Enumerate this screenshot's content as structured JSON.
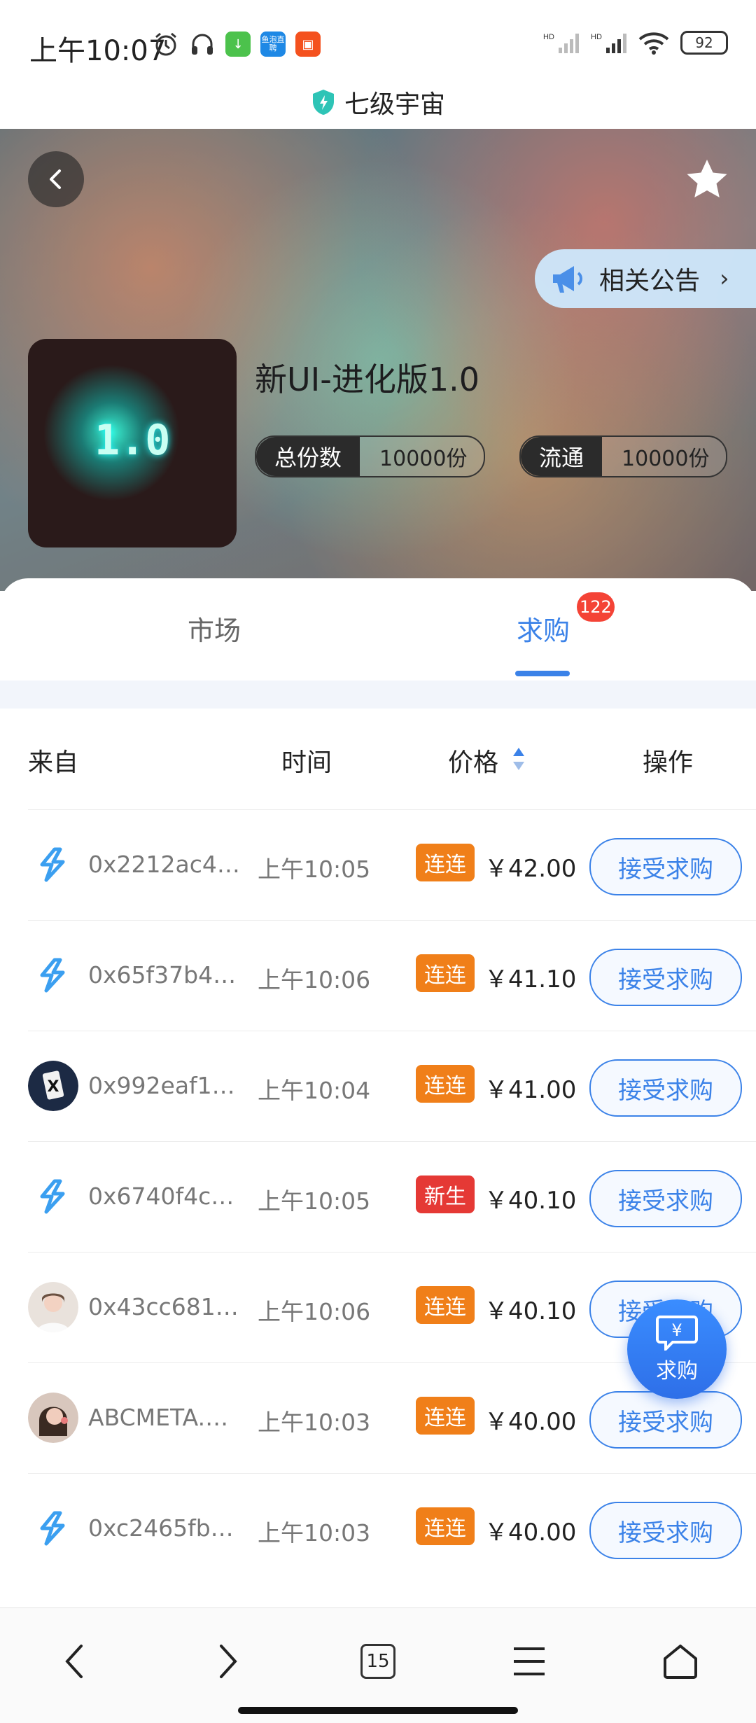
{
  "status_bar": {
    "time": "上午10:07",
    "battery": "92",
    "app_icon_texts": [
      "鱼泡直聘"
    ]
  },
  "app_bar": {
    "title": "七级宇宙"
  },
  "hero": {
    "notice_label": "相关公告",
    "product_name": "新UI-进化版1.0",
    "cover_text": "1.0",
    "stats": [
      {
        "key": "总份数",
        "value": "10000份"
      },
      {
        "key": "流通",
        "value": "10000份"
      }
    ]
  },
  "tabs": {
    "market": "市场",
    "buy": "求购",
    "buy_badge": "122",
    "active": "buy"
  },
  "table": {
    "headers": {
      "from": "来自",
      "time": "时间",
      "price": "价格",
      "op": "操作"
    },
    "rows": [
      {
        "addr": "0x2212ac4…",
        "time": "上午10:05",
        "tag": "连连",
        "tag_color": "orange",
        "price": "￥42.00",
        "action": "接受求购",
        "avatar": "bolt"
      },
      {
        "addr": "0x65f37b4…",
        "time": "上午10:06",
        "tag": "连连",
        "tag_color": "orange",
        "price": "￥41.10",
        "action": "接受求购",
        "avatar": "bolt"
      },
      {
        "addr": "0x992eaf1…",
        "time": "上午10:04",
        "tag": "连连",
        "tag_color": "orange",
        "price": "￥41.00",
        "action": "接受求购",
        "avatar": "card"
      },
      {
        "addr": "0x6740f4c…",
        "time": "上午10:05",
        "tag": "新生",
        "tag_color": "red",
        "price": "￥40.10",
        "action": "接受求购",
        "avatar": "bolt"
      },
      {
        "addr": "0x43cc681…",
        "time": "上午10:06",
        "tag": "连连",
        "tag_color": "orange",
        "price": "￥40.10",
        "action": "接受求购",
        "avatar": "person1"
      },
      {
        "addr": "ABCMETA.…",
        "time": "上午10:03",
        "tag": "连连",
        "tag_color": "orange",
        "price": "￥40.00",
        "action": "接受求购",
        "avatar": "person2"
      },
      {
        "addr": "0xc2465fb…",
        "time": "上午10:03",
        "tag": "连连",
        "tag_color": "orange",
        "price": "￥40.00",
        "action": "接受求购",
        "avatar": "bolt"
      }
    ]
  },
  "fab": {
    "symbol": "¥",
    "label": "求购"
  },
  "bottom_bar": {
    "tab_count": "15"
  },
  "colors": {
    "accent": "#3b82e8",
    "tag_orange": "#f07f19",
    "tag_red": "#e53935",
    "badge_red": "#f44336"
  }
}
